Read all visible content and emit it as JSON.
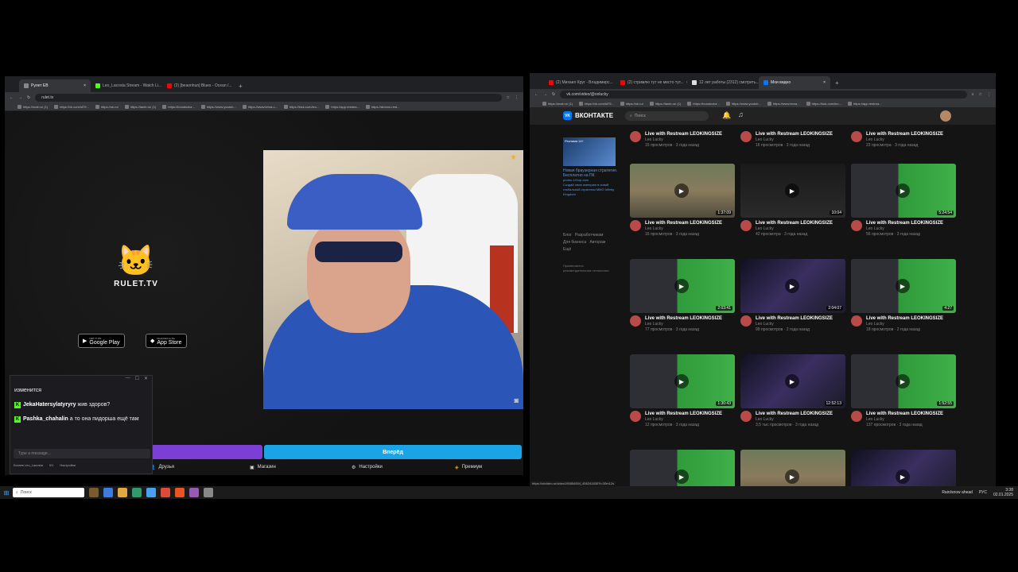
{
  "left_browser": {
    "tabs": [
      {
        "label": "Рулет ЕВ",
        "color": "#888888",
        "active": true
      },
      {
        "label": "Leo_Lacosta Stream - Watch Li...",
        "color": "#53fc18",
        "active": false
      },
      {
        "label": "(2) [beaonhun] Blues - Ocean /...",
        "color": "#ff0000",
        "active": false
      }
    ],
    "url": "rulet.tv",
    "bookmarks": [
      "https://mail.ru/ (1)",
      "https://vk.com/id79...",
      "https://ok.ru/",
      "https://lamb.ru/ (1)",
      "https://boostcolor...",
      "https://www.youtub...",
      "https://www.tema.u...",
      "https://kick.com/leo...",
      "https://app.restrea...",
      "https://dronno.rest..."
    ]
  },
  "rulet": {
    "logo_text": "RULET.TV",
    "google_play_small": "GET IT ON",
    "google_play": "Google Play",
    "app_store_small": "Download on the",
    "app_store": "App Store",
    "next_button": "Вперёд",
    "nav": [
      {
        "icon": "user-icon",
        "label": "Друзья"
      },
      {
        "icon": "shop-icon",
        "label": "Магазин"
      },
      {
        "icon": "gear-icon",
        "label": "Настройки"
      },
      {
        "icon": "tag-icon",
        "label": "Премиум"
      }
    ]
  },
  "chat": {
    "messages": [
      {
        "user": "",
        "text": "изменится"
      },
      {
        "user": "JekaHatersylatyryry",
        "text": "жив здоров?"
      },
      {
        "user": "Pashka_chahalin",
        "text": "а то она пидорша ещё там"
      }
    ],
    "input_placeholder": "Type a message...",
    "footer_user": "Богаев Leo_Lacosta",
    "footer_count": "0/1",
    "footer_settings": "Настройки"
  },
  "right_browser": {
    "tabs": [
      {
        "label": "(2) Михаил Круг - Владимирс...",
        "color": "#ff0000",
        "active": false
      },
      {
        "label": "(2) стримлю тут не место тут...",
        "color": "#ff0000",
        "active": false
      },
      {
        "label": "12 лет работы (2312) смотреть...",
        "color": "#dddddd",
        "active": false
      },
      {
        "label": "Мои видео",
        "color": "#0077ff",
        "active": true
      }
    ],
    "url": "vk.com/video/@ooluckу",
    "bookmarks": [
      "https://mail.ru/ (1)",
      "https://vk.com/id79...",
      "https://ok.ru/",
      "https://lamb.ru/ (1)",
      "https://boostcolor...",
      "https://www.youtub...",
      "https://www.tema...",
      "https://kick.com/leo...",
      "https://app.restrea..."
    ],
    "status_url": "https://vkvideo.ru/video195854954_456241830?t=30m12s"
  },
  "vk": {
    "logo_text": "ВКОНТАКТЕ",
    "search_placeholder": "Поиск",
    "ad": {
      "badge": "Реклама 14+",
      "title": "Новая браузерная стратегия. Бесплатно на ПК",
      "domain": "promo.101xp.com",
      "text": "Создай свою империю в новой глобальной стратегии MMO Infinity Kingdom"
    },
    "side_links": [
      "Блог",
      "Разработчикам",
      "Для бизнеса",
      "Авторам",
      "Ещё"
    ],
    "side_note": "Применяются рекомендательные технологии",
    "videos": [
      {
        "title": "Live with Restream LEOKINGSIZE",
        "channel": "Leo Lucky",
        "views": "15 просмотров · 3 года назад",
        "duration": "",
        "theme": "none"
      },
      {
        "title": "Live with Restream LEOKINGSIZE",
        "channel": "Leo Lucky",
        "views": "16 просмотров · 3 года назад",
        "duration": "",
        "theme": "none"
      },
      {
        "title": "Live with Restream LEOKINGSIZE",
        "channel": "Leo Lucky",
        "views": "23 просмотра · 3 года назад",
        "duration": "",
        "theme": "none"
      },
      {
        "title": "Live with Restream LEOKINGSIZE",
        "channel": "Leo Lucky",
        "views": "16 просмотров · 3 года назад",
        "duration": "1:37:09",
        "theme": "game"
      },
      {
        "title": "Live with Restream LEOKINGSIZE",
        "channel": "Leo Lucky",
        "views": "42 просмотра · 3 года назад",
        "duration": "10:04",
        "theme": "dark"
      },
      {
        "title": "Live with Restream LEOKINGSIZE",
        "channel": "Leo Lucky",
        "views": "56 просмотров · 3 года назад",
        "duration": "5:24:54",
        "theme": "green"
      },
      {
        "title": "Live with Restream LEOKINGSIZE",
        "channel": "Leo Lucky",
        "views": "77 просмотров · 3 года назад",
        "duration": "2:03:41",
        "theme": "green"
      },
      {
        "title": "Live with Restream LEOKINGSIZE",
        "channel": "Leo Lucky",
        "views": "99 просмотров · 2 года назад",
        "duration": "2:04:07",
        "theme": "screen"
      },
      {
        "title": "Live with Restream LEOKINGSIZE",
        "channel": "Leo Lucky",
        "views": "18 просмотров · 2 года назад",
        "duration": "4:27",
        "theme": "green"
      },
      {
        "title": "Live with Restream LEOKINGSIZE",
        "channel": "Leo Lucky",
        "views": "12 просмотров · 3 года назад",
        "duration": "1:30:43",
        "theme": "green"
      },
      {
        "title": "Live with Restream LEOKINGSIZE",
        "channel": "Leo Lucky",
        "views": "3,5 тыс просмотров · 3 года назад",
        "duration": "12:52:13",
        "theme": "screen"
      },
      {
        "title": "Live with Restream LEOKINGSIZE",
        "channel": "Leo Lucky",
        "views": "137 просмотров · 3 года назад",
        "duration": "1:52:55",
        "theme": "green"
      },
      {
        "title": "",
        "channel": "",
        "views": "",
        "duration": "",
        "theme": "green"
      },
      {
        "title": "",
        "channel": "",
        "views": "",
        "duration": "",
        "theme": "game"
      },
      {
        "title": "",
        "channel": "",
        "views": "",
        "duration": "",
        "theme": "screen"
      }
    ]
  },
  "taskbar": {
    "search_placeholder": "Поиск",
    "weather": "Rain/snow ahead",
    "lang": "РУС",
    "time": "3:38",
    "date": "02.01.2025"
  }
}
